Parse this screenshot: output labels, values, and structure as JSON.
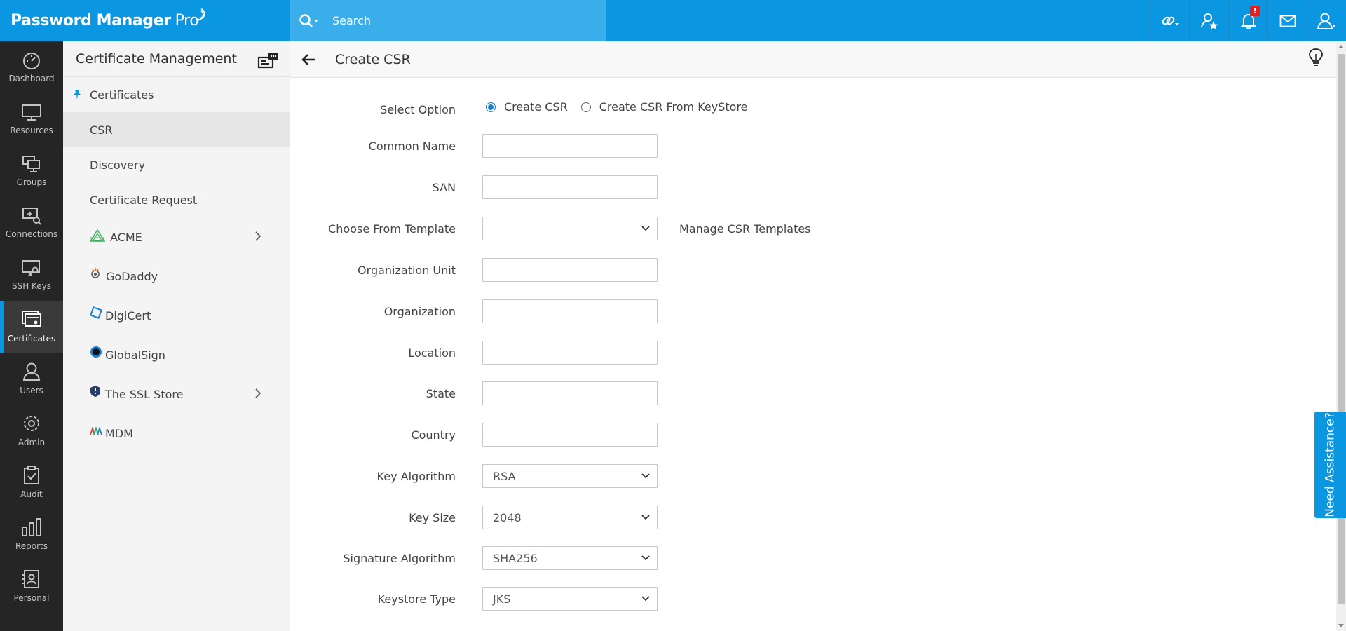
{
  "header": {
    "brand": "Password Manager",
    "brand_pro": "Pro",
    "search_placeholder": "Search",
    "notification_count": "!",
    "icons": [
      "link-icon",
      "favorite-user-icon",
      "bell-icon",
      "mail-icon",
      "user-icon"
    ]
  },
  "leftnav": {
    "items": [
      {
        "label": "Dashboard",
        "icon": "dashboard-icon"
      },
      {
        "label": "Resources",
        "icon": "monitor-icon"
      },
      {
        "label": "Groups",
        "icon": "groups-icon"
      },
      {
        "label": "Connections",
        "icon": "connections-icon"
      },
      {
        "label": "SSH Keys",
        "icon": "ssh-key-icon"
      },
      {
        "label": "Certificates",
        "icon": "certificate-icon"
      },
      {
        "label": "Users",
        "icon": "user-icon"
      },
      {
        "label": "Admin",
        "icon": "gear-icon"
      },
      {
        "label": "Audit",
        "icon": "clipboard-check-icon"
      },
      {
        "label": "Reports",
        "icon": "bar-chart-icon"
      },
      {
        "label": "Personal",
        "icon": "contact-card-icon"
      }
    ],
    "active": "Certificates"
  },
  "subside": {
    "title": "Certificate Management",
    "items": [
      {
        "label": "Certificates"
      },
      {
        "label": "CSR"
      },
      {
        "label": "Discovery"
      },
      {
        "label": "Certificate Request"
      }
    ],
    "vendors": [
      {
        "label": "ACME"
      },
      {
        "label": "GoDaddy"
      },
      {
        "label": "DigiCert"
      },
      {
        "label": "GlobalSign"
      },
      {
        "label": "The SSL Store"
      },
      {
        "label": "MDM"
      }
    ]
  },
  "main": {
    "title": "Create CSR",
    "select_option": {
      "label": "Select Option",
      "options": [
        "Create CSR",
        "Create CSR From KeyStore"
      ],
      "selected": "Create CSR"
    },
    "fields": {
      "common_name": {
        "label": "Common Name",
        "value": ""
      },
      "san": {
        "label": "SAN",
        "value": ""
      },
      "template": {
        "label": "Choose From Template",
        "value": ""
      },
      "manage_templates": "Manage CSR Templates",
      "org_unit": {
        "label": "Organization Unit",
        "value": ""
      },
      "organization": {
        "label": "Organization",
        "value": ""
      },
      "location": {
        "label": "Location",
        "value": ""
      },
      "state": {
        "label": "State",
        "value": ""
      },
      "country": {
        "label": "Country",
        "value": ""
      },
      "key_algorithm": {
        "label": "Key Algorithm",
        "value": "RSA"
      },
      "key_size": {
        "label": "Key Size",
        "value": "2048"
      },
      "signature_algorithm": {
        "label": "Signature Algorithm",
        "value": "SHA256"
      },
      "keystore_type": {
        "label": "Keystore Type",
        "value": "JKS"
      }
    }
  },
  "assist": {
    "label": "Need Assistance?"
  },
  "colors": {
    "brand_blue": "#0a96e0",
    "nav_bg": "#252525",
    "notif_red": "#e02020",
    "radio_blue": "#1a7fd4"
  }
}
